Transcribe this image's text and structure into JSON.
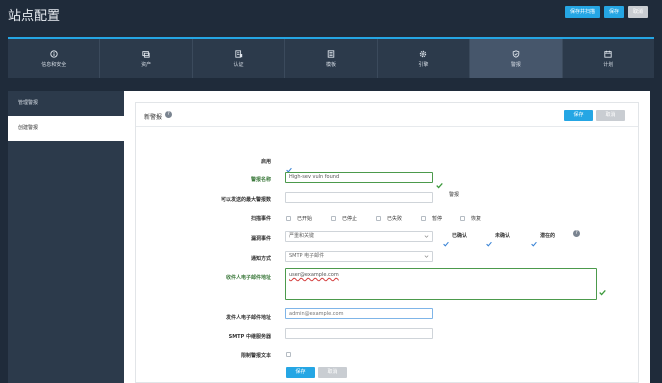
{
  "header": {
    "title": "站点配置",
    "buttons": {
      "save_scan": "保存并扫描",
      "save": "保存",
      "cancel": "取消"
    }
  },
  "tabs": [
    {
      "label": "信息和安全",
      "icon": "info-icon"
    },
    {
      "label": "资产",
      "icon": "assets-icon"
    },
    {
      "label": "认证",
      "icon": "auth-icon"
    },
    {
      "label": "模板",
      "icon": "template-icon"
    },
    {
      "label": "引擎",
      "icon": "gear-icon"
    },
    {
      "label": "警报",
      "icon": "shield-icon",
      "active": true
    },
    {
      "label": "计划",
      "icon": "calendar-icon"
    }
  ],
  "sidebar": {
    "items": [
      {
        "label": "管理警报"
      },
      {
        "label": "创建警报",
        "active": true
      }
    ]
  },
  "panel": {
    "title": "新警报",
    "save": "保存",
    "cancel": "取消"
  },
  "form": {
    "enabled": {
      "label": "启用",
      "checked": true
    },
    "alert_name": {
      "label": "警报名称",
      "value": "High-sev vuln found"
    },
    "max_alerts": {
      "label": "可以发送的最大警报数",
      "value": "",
      "suffix": "警报"
    },
    "scan_events": {
      "label": "扫描事件",
      "options": [
        "已开始",
        "已停止",
        "已失败",
        "暂停",
        "恢复"
      ]
    },
    "vuln_events": {
      "label": "漏洞事件",
      "select": "严重和关键",
      "options": [
        {
          "label": "已确认",
          "checked": true
        },
        {
          "label": "未确认",
          "checked": true
        },
        {
          "label": "潜在的",
          "checked": true
        }
      ]
    },
    "notify": {
      "label": "通知方式",
      "value": "SMTP 电子邮件"
    },
    "recipients": {
      "label": "收件人电子邮件地址",
      "value": "user@example.com"
    },
    "sender": {
      "label": "发件人电子邮件地址",
      "placeholder": "admin@example.com"
    },
    "relay": {
      "label": "SMTP 中继服务器",
      "value": ""
    },
    "limit_text": {
      "label": "限制警报文本"
    },
    "save": "保存",
    "cancel": "取消"
  }
}
